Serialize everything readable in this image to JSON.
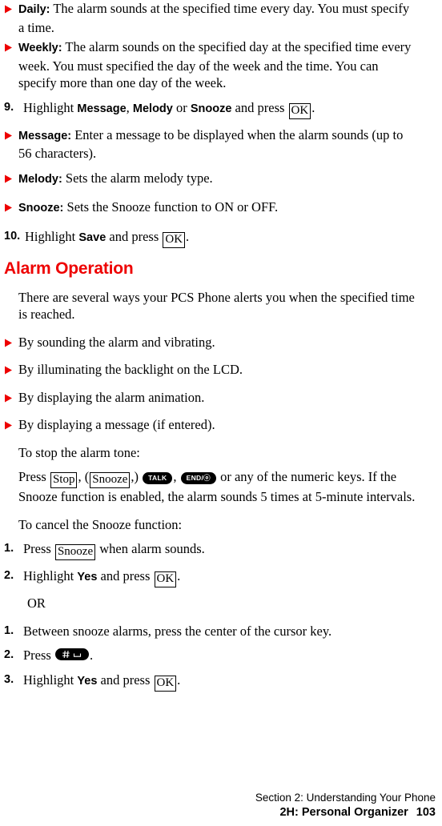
{
  "colors": {
    "bullet_red": "#ee0000",
    "heading_red": "#ee0000",
    "text": "#000000",
    "page_background": "#ffffff",
    "key_pill_background": "#000000",
    "key_pill_text": "#ffffff"
  },
  "bullets": {
    "daily": {
      "term": "Daily:",
      "text": " The alarm sounds at the specified time every day. You must specify a time."
    },
    "weekly": {
      "term": "Weekly:",
      "text": " The alarm sounds on the specified day at the specified time every week. You must specified the day of the week and the time. You can specify more than one day of the week."
    },
    "message": {
      "term": "Message:",
      "text": " Enter a message to be displayed when the alarm sounds (up to 56 characters)."
    },
    "melody": {
      "term": "Melody:",
      "text": " Sets the alarm melody type."
    },
    "snooze": {
      "term": "Snooze:",
      "text": " Sets the Snooze function to ON or OFF."
    },
    "alert_sound": "By sounding the alarm and vibrating.",
    "alert_backlight": "By illuminating the backlight on the LCD.",
    "alert_animation": "By displaying the alarm animation.",
    "alert_message": "By displaying a message (if entered)."
  },
  "steps": {
    "step9": {
      "number": "9.",
      "pre": "Highlight ",
      "bold1": "Message",
      "sep1": ", ",
      "bold2": "Melody",
      "sep2": " or ",
      "bold3": "Snooze",
      "mid": " and press ",
      "key": "OK",
      "post": "."
    },
    "step10": {
      "number": "10.",
      "pre": "Highlight ",
      "bold1": "Save",
      "mid": " and press ",
      "key": "OK",
      "post": "."
    }
  },
  "alarm_operation": {
    "heading": "Alarm Operation",
    "intro": "There are several ways your PCS Phone alerts you when the specified time is reached.",
    "stop_label": "To stop the alarm tone:",
    "stop_paragraph": {
      "pre": "Press ",
      "key_stop": "Stop",
      "sep1": ", (",
      "key_snooze": "Snooze",
      "sep2": ",) ",
      "key_talk": "TALK",
      "sep3": ", ",
      "key_end": "END/",
      "key_end_symbol": "ⓞ",
      "post": " or any of the numeric keys. If the Snooze function is enabled, the alarm sounds 5 times at 5-minute intervals."
    },
    "cancel_label": "To cancel the Snooze function:",
    "cancel_steps": {
      "step1": {
        "number": "1.",
        "pre": "Press ",
        "key": "Snooze",
        "post": " when alarm sounds."
      },
      "step2": {
        "number": "2.",
        "pre": "Highlight ",
        "bold1": "Yes",
        "mid": " and press ",
        "key": "OK",
        "post": "."
      },
      "or": "OR",
      "alt_step1": {
        "number": "1.",
        "text": "Between snooze alarms, press the center of the cursor key."
      },
      "alt_step2": {
        "number": "2.",
        "pre": "Press ",
        "key_icon": "pound-space-key-icon",
        "post": "."
      },
      "alt_step3": {
        "number": "3.",
        "pre": "Highlight ",
        "bold1": "Yes",
        "mid": " and press ",
        "key": "OK",
        "post": "."
      }
    }
  },
  "footer": {
    "section": "Section 2: Understanding Your Phone",
    "chapter": "2H: Personal Organizer",
    "page_number": "103"
  }
}
